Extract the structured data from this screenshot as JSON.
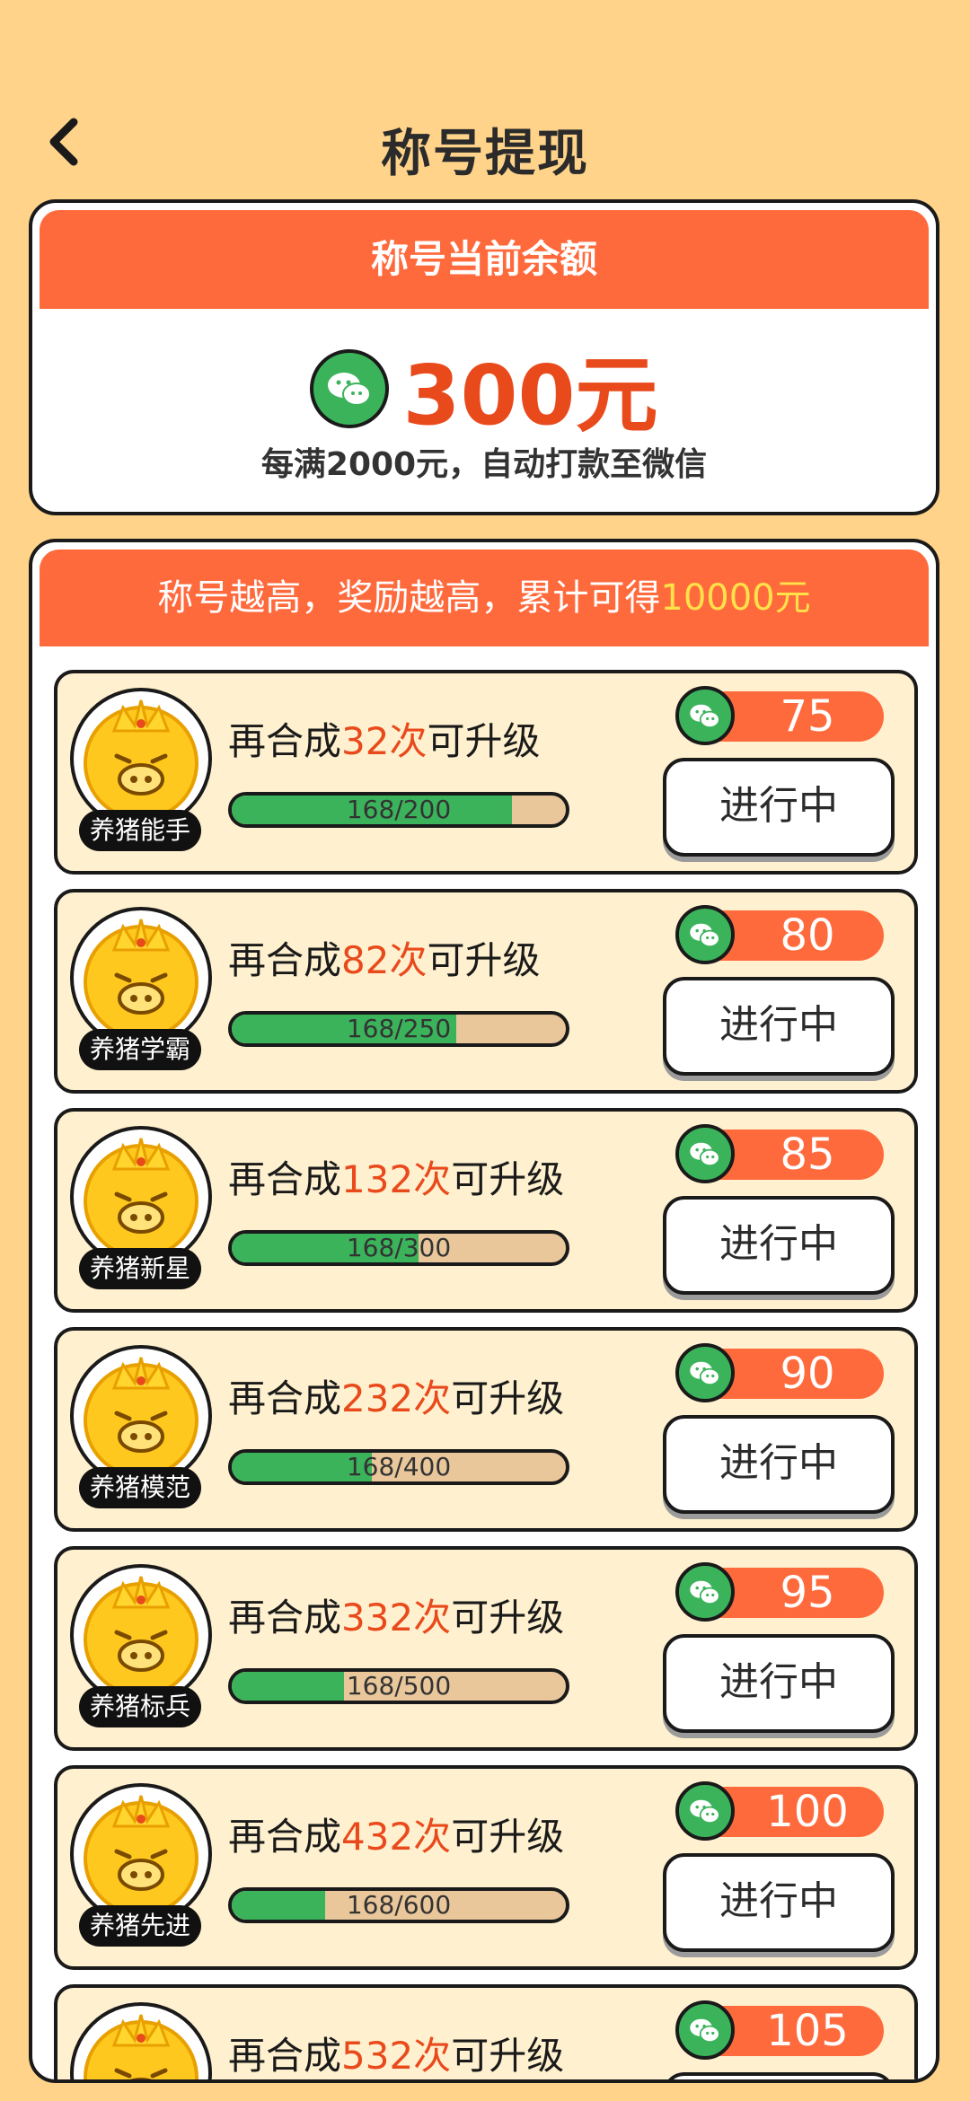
{
  "header": {
    "title": "称号提现"
  },
  "balance": {
    "head": "称号当前余额",
    "amount": "300元",
    "note": "每满2000元，自动打款至微信"
  },
  "list": {
    "head_pre": "称号越高，奖励越高，累计可得",
    "head_hl": "10000元",
    "items": [
      {
        "pre": "再合成",
        "num": "32次",
        "post": "可升级",
        "progress": "168/200",
        "fill": 0.84,
        "reward": "75",
        "status": "进行中",
        "badge": "养猪能手"
      },
      {
        "pre": "再合成",
        "num": "82次",
        "post": "可升级",
        "progress": "168/250",
        "fill": 0.672,
        "reward": "80",
        "status": "进行中",
        "badge": "养猪学霸"
      },
      {
        "pre": "再合成",
        "num": "132次",
        "post": "可升级",
        "progress": "168/300",
        "fill": 0.56,
        "reward": "85",
        "status": "进行中",
        "badge": "养猪新星"
      },
      {
        "pre": "再合成",
        "num": "232次",
        "post": "可升级",
        "progress": "168/400",
        "fill": 0.42,
        "reward": "90",
        "status": "进行中",
        "badge": "养猪模范"
      },
      {
        "pre": "再合成",
        "num": "332次",
        "post": "可升级",
        "progress": "168/500",
        "fill": 0.336,
        "reward": "95",
        "status": "进行中",
        "badge": "养猪标兵"
      },
      {
        "pre": "再合成",
        "num": "432次",
        "post": "可升级",
        "progress": "168/600",
        "fill": 0.28,
        "reward": "100",
        "status": "进行中",
        "badge": "养猪先进"
      },
      {
        "pre": "再合成",
        "num": "532次",
        "post": "可升级",
        "progress": "",
        "fill": 0.24,
        "reward": "105",
        "status": "",
        "badge": ""
      }
    ]
  },
  "colors": {
    "accent": "#FF6A3D",
    "green": "#3BB35B",
    "bg": "#FFD38A"
  },
  "icons": {
    "back": "chevron-left-icon",
    "wechat": "wechat-icon",
    "avatar": "pig-crown-icon"
  }
}
